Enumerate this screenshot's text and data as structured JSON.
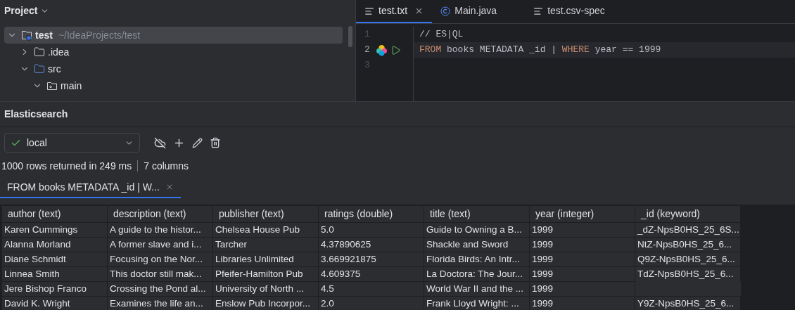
{
  "project_panel": {
    "title": "Project",
    "tree": [
      {
        "label": "test",
        "path": "~/IdeaProjects/test",
        "kind": "module",
        "expanded": true,
        "selected": true,
        "children": [
          {
            "label": ".idea",
            "kind": "folder",
            "expanded": false,
            "selected": false
          },
          {
            "label": "src",
            "kind": "source",
            "expanded": true,
            "selected": false,
            "children": [
              {
                "label": "main",
                "kind": "package",
                "expanded": true,
                "selected": false
              }
            ]
          }
        ]
      }
    ]
  },
  "editor": {
    "tabs": [
      {
        "label": "test.txt",
        "kind": "text",
        "selected": true,
        "closable": true
      },
      {
        "label": "Main.java",
        "kind": "class",
        "selected": false,
        "closable": false
      },
      {
        "label": "test.csv-spec",
        "kind": "text",
        "selected": false,
        "closable": false
      }
    ],
    "lines": [
      {
        "number": "1",
        "current": false,
        "runnable": false,
        "tokens": [
          {
            "kind": "comment",
            "text": "// ES|QL"
          }
        ]
      },
      {
        "number": "2",
        "current": true,
        "runnable": true,
        "tokens": [
          {
            "kind": "keyword",
            "text": "FROM"
          },
          {
            "kind": "plain",
            "text": " books METADATA _id | "
          },
          {
            "kind": "keyword",
            "text": "WHERE"
          },
          {
            "kind": "plain",
            "text": " year == 1999"
          }
        ]
      },
      {
        "number": "3",
        "current": false,
        "runnable": false
      }
    ]
  },
  "elastic_panel": {
    "title": "Elasticsearch",
    "connection": {
      "value": "local",
      "connected": true
    },
    "status": [
      "1000 rows returned in 249 ms",
      "7 columns"
    ],
    "result_tabs": [
      {
        "label": "FROM books METADATA _id | W...",
        "selected": true
      }
    ],
    "table": {
      "columns": [
        "author (text)",
        "description (text)",
        "publisher (text)",
        "ratings (double)",
        "title (text)",
        "year (integer)",
        "_id (keyword)"
      ],
      "rows": [
        [
          "Karen Cummings",
          "A guide to the histor...",
          "Chelsea House Pub",
          "5.0",
          "Guide to Owning a B...",
          "1999",
          "_dZ-NpsB0HS_25_6S..."
        ],
        [
          "Alanna Morland",
          "A former slave and i...",
          "Tarcher",
          "4.37890625",
          "Shackle and Sword",
          "1999",
          "NtZ-NpsB0HS_25_6..."
        ],
        [
          "Diane Schmidt",
          "Focusing on the Nor...",
          "Libraries Unlimited",
          "3.669921875",
          "Florida Birds: An Intr...",
          "1999",
          "Q9Z-NpsB0HS_25_6..."
        ],
        [
          "Linnea Smith",
          "This doctor still mak...",
          "Pfeifer-Hamilton Pub",
          "4.609375",
          "La Doctora: The Jour...",
          "1999",
          "TdZ-NpsB0HS_25_6..."
        ],
        [
          "Jere Bishop Franco",
          "Crossing the Pond al...",
          "University of North ...",
          "4.5",
          "World War II and the ...",
          "1999"
        ],
        [
          "David K. Wright",
          "Examines the life an...",
          "Enslow Pub Incorpor...",
          "2.0",
          "Frank Lloyd Wright: ...",
          "1999",
          "Y9Z-NpsB0HS_25_6..."
        ]
      ]
    }
  }
}
